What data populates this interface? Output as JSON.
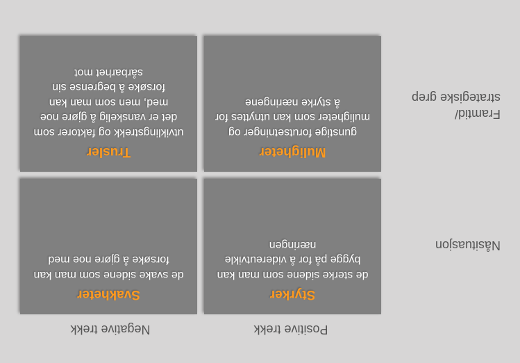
{
  "diagram": {
    "columns": {
      "positive": "Positive trekk",
      "negative": "Negative trekk"
    },
    "rows": {
      "present": "Nåsituasjon",
      "future": "Framtid/\nstrategiske grep"
    },
    "cells": {
      "strengths": {
        "title": "Styrker",
        "desc": "de sterke sidene som man kan bygge på for å videreutvikle næringen"
      },
      "weaknesses": {
        "title": "Svakheter",
        "desc": "de svake sidene som man kan forsøke å gjøre noe med"
      },
      "opportunities": {
        "title": "Muligheter",
        "desc": "gunstige forutsetninger og muligheter som kan utnyttes for å styrke næringene"
      },
      "threats": {
        "title": "Trusler",
        "desc": "utviklingstrekk og faktorer som det er vanskelig å gjøre noe med, men som man kan forsøke å begrense sin sårbarhet mot"
      }
    }
  }
}
